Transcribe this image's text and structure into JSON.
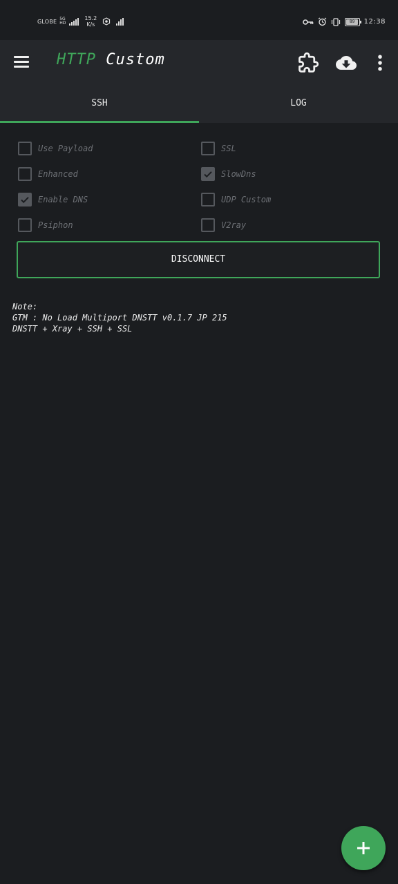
{
  "status_bar": {
    "carrier": "GLOBE",
    "network": [
      "5G",
      "HD"
    ],
    "speed_value": "15.2",
    "speed_unit": "K/s",
    "time": "12:38",
    "battery": "89"
  },
  "app_bar": {
    "title_part1": "HTTP",
    "title_part2": "Custom",
    "icons": [
      "menu-icon",
      "extension-puzzle-icon",
      "cloud-download-icon",
      "more-vert-icon"
    ]
  },
  "tabs": [
    {
      "label": "SSH",
      "active": true
    },
    {
      "label": "LOG",
      "active": false
    }
  ],
  "options": [
    {
      "label": "Use Payload",
      "checked": false
    },
    {
      "label": "SSL",
      "checked": false
    },
    {
      "label": "Enhanced",
      "checked": false
    },
    {
      "label": "SlowDns",
      "checked": true
    },
    {
      "label": "Enable DNS",
      "checked": true
    },
    {
      "label": "UDP Custom",
      "checked": false
    },
    {
      "label": "Psiphon",
      "checked": false
    },
    {
      "label": "V2ray",
      "checked": false
    }
  ],
  "disconnect_label": "DISCONNECT",
  "note": {
    "heading": "Note:",
    "line1": "GTM : No Load Multiport DNSTT v0.1.7 JP 215",
    "line2": "DNSTT + Xray + SSH + SSL"
  },
  "fab_icon": "plus-icon",
  "colors": {
    "accent": "#3fa65a",
    "background": "#1b1d20",
    "toolbar": "#25272b"
  }
}
